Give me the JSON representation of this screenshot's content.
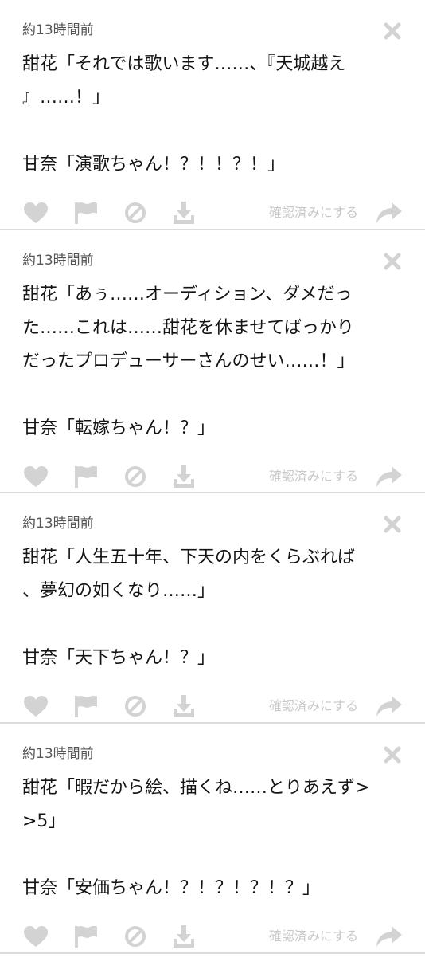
{
  "colors": {
    "icon": "#d3d3d3",
    "divider": "#dcdcdc",
    "text": "#141414",
    "meta": "#555555"
  },
  "posts": [
    {
      "timestamp": "約13時間前",
      "lines": "甜花「それでは歌います……、『天城越え\n』……！」\n\n甘奈「演歌ちゃん！？！！？！」",
      "confirm_label": "確認済みにする"
    },
    {
      "timestamp": "約13時間前",
      "lines": "甜花「あぅ……オーディション、ダメだっ\nた……これは……甜花を休ませてばっかり\nだったプロデューサーさんのせい……！」\n\n甘奈「転嫁ちゃん！？」",
      "confirm_label": "確認済みにする"
    },
    {
      "timestamp": "約13時間前",
      "lines": "甜花「人生五十年、下天の内をくらぶれば\n、夢幻の如くなり……」\n\n甘奈「天下ちゃん！？」",
      "confirm_label": "確認済みにする"
    },
    {
      "timestamp": "約13時間前",
      "lines": "甜花「暇だから絵、描くね……とりあえず>\n>5」\n\n甘奈「安価ちゃん！？！？！？！？」",
      "confirm_label": "確認済みにする"
    }
  ],
  "icons": {
    "like": "heart-icon",
    "report": "flag-icon",
    "block": "block-icon",
    "save": "download-icon",
    "share": "share-arrow-icon",
    "close": "close-icon"
  }
}
